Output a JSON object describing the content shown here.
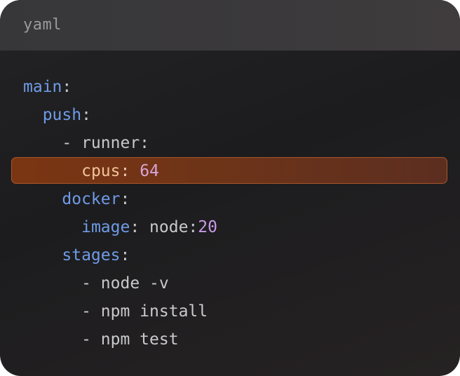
{
  "header": {
    "language": "yaml"
  },
  "code": {
    "lines": [
      {
        "indent": "",
        "key": "main",
        "colon": ":"
      },
      {
        "indent": "  ",
        "key": "push",
        "colon": ":"
      },
      {
        "indent": "    ",
        "prefix": "- runner:"
      },
      {
        "indent": "      ",
        "key": "cpus",
        "colon": ": ",
        "value": "64"
      },
      {
        "indent": "    ",
        "key": "docker",
        "colon": ":"
      },
      {
        "indent": "      ",
        "key": "image",
        "colon": ": ",
        "value_text": "node:",
        "value": "20"
      },
      {
        "indent": "    ",
        "key": "stages",
        "colon": ":"
      },
      {
        "indent": "      ",
        "item": "- node -v"
      },
      {
        "indent": "      ",
        "item": "- npm install"
      },
      {
        "indent": "      ",
        "item": "- npm test"
      }
    ]
  },
  "colors": {
    "background": "#1c1c1e",
    "header": "#3a383a",
    "key": "#6f9be6",
    "number": "#c89ae9",
    "highlight": "#7b3512"
  }
}
